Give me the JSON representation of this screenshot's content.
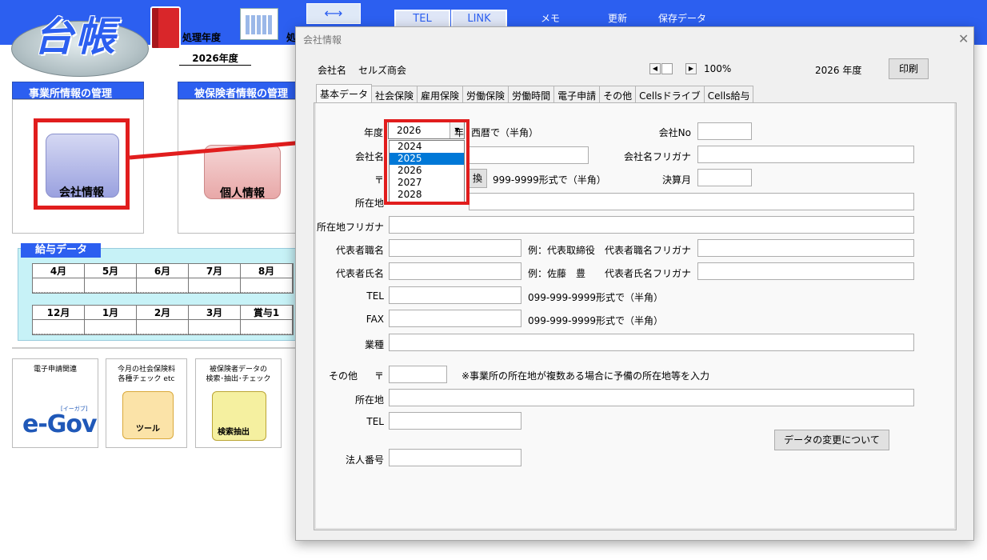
{
  "app": {
    "logo_text": "台帳",
    "processing_year_label": "処理年度",
    "processing_label2": "処",
    "processing_year_value": "2026年度",
    "top_buttons": [
      "TEL",
      "LINK"
    ],
    "top_menu": [
      "メモ",
      "更新",
      "保存データ"
    ],
    "section_office": "事業所情報の管理",
    "section_insured": "被保険者情報の管理",
    "company_info_label": "会社情報",
    "personal_info_label": "個人情報",
    "salary_section": "給与データ",
    "months_row1": [
      "4月",
      "5月",
      "6月",
      "7月",
      "8月"
    ],
    "months_row2": [
      "12月",
      "1月",
      "2月",
      "3月",
      "賞与1"
    ],
    "tile_egov_title": "電子申請関連",
    "tile_egov_logo": "e-Gov",
    "tile_egov_sub": "[イーガブ]",
    "tile_check_title": "今月の社会保険料\n各種チェック etc",
    "tile_check_img": "ツール",
    "tile_search_title": "被保険者データの\n検索･抽出･チェック",
    "tile_search_img": "検索抽出"
  },
  "dialog": {
    "title": "会社情報",
    "company_label": "会社名",
    "company_value": "セルズ商会",
    "zoom": "100%",
    "year_display": "2026 年度",
    "print_button": "印刷",
    "tabs": [
      "基本データ",
      "社会保険",
      "雇用保険",
      "労働保険",
      "労働時間",
      "電子申請",
      "その他",
      "Cellsドライブ",
      "Cells給与"
    ],
    "form": {
      "year_label": "年度",
      "year_value": "2026",
      "year_suffix": "年",
      "year_hint": "西暦で（半角）",
      "company_no_label": "会社No",
      "company_name_label": "会社名",
      "company_name_kana_label": "会社名フリガナ",
      "postal_label": "〒",
      "convert_button": "換",
      "postal_hint": "999-9999形式で（半角）",
      "fiscal_month_label": "決算月",
      "address_label": "所在地",
      "address_kana_label": "所在地フリガナ",
      "rep_title_label": "代表者職名",
      "rep_title_example": "例：代表取締役",
      "rep_title_kana_label": "代表者職名フリガナ",
      "rep_name_label": "代表者氏名",
      "rep_name_example": "例：佐藤　豊",
      "rep_name_kana_label": "代表者氏名フリガナ",
      "tel_label": "TEL",
      "tel_hint": "099-999-9999形式で（半角）",
      "fax_label": "FAX",
      "fax_hint": "099-999-9999形式で（半角）",
      "industry_label": "業種",
      "other_label": "その他",
      "other_postal_label": "〒",
      "other_note": "※事業所の所在地が複数ある場合に予備の所在地等を入力",
      "other_address_label": "所在地",
      "other_tel_label": "TEL",
      "data_change_button": "データの変更について",
      "corp_number_label": "法人番号"
    },
    "year_options": [
      "2024",
      "2025",
      "2026",
      "2027",
      "2028"
    ],
    "year_highlighted": "2025"
  },
  "colors": {
    "accent_blue": "#2c5ff0",
    "highlight_red": "#e11d1d",
    "selection_blue": "#0078d7"
  }
}
